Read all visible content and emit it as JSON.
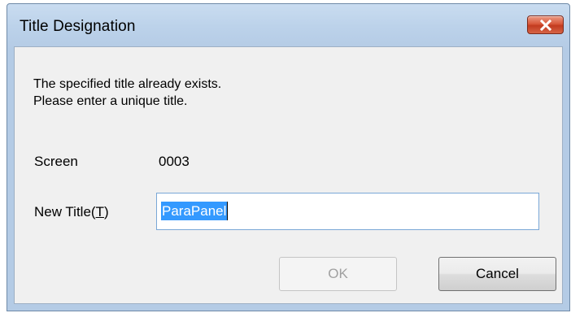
{
  "window": {
    "title": "Title Designation",
    "close_icon": "close-x-icon",
    "close_button_color": "#c83c22"
  },
  "message": {
    "line1": "The specified title already exists.",
    "line2": "Please enter a unique title."
  },
  "screen": {
    "label": "Screen",
    "value": "0003"
  },
  "new_title": {
    "label_prefix": "New Title(",
    "label_accel": "T",
    "label_suffix": ")",
    "value": "ParaPanel",
    "selected": true
  },
  "buttons": {
    "ok_label": "OK",
    "ok_enabled": false,
    "cancel_label": "Cancel"
  },
  "colors": {
    "selection": "#3399ff",
    "input_border": "#7aa7d6",
    "dialog_background": "#f0f0f0"
  }
}
